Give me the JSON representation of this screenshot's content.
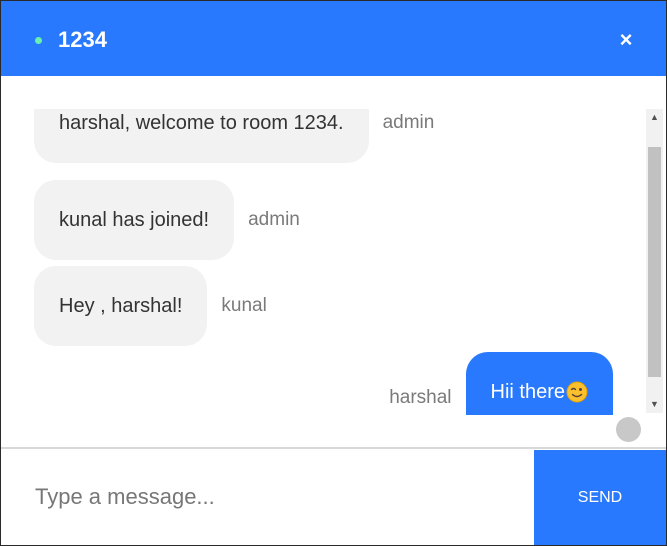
{
  "header": {
    "room_name": "1234",
    "close_glyph": "×",
    "status_color": "#69f0ae",
    "accent_color": "#2979ff"
  },
  "messages": [
    {
      "text": "harshal, welcome to room 1234.",
      "sender": "admin",
      "direction": "incoming"
    },
    {
      "text": "kunal has joined!",
      "sender": "admin",
      "direction": "incoming"
    },
    {
      "text": "Hey , harshal!",
      "sender": "kunal",
      "direction": "incoming"
    },
    {
      "text": "Hii there",
      "sender": "harshal",
      "direction": "outgoing",
      "emoji": "winking-smile-icon"
    }
  ],
  "composer": {
    "placeholder": "Type a message...",
    "value": "",
    "send_label": "SEND"
  }
}
